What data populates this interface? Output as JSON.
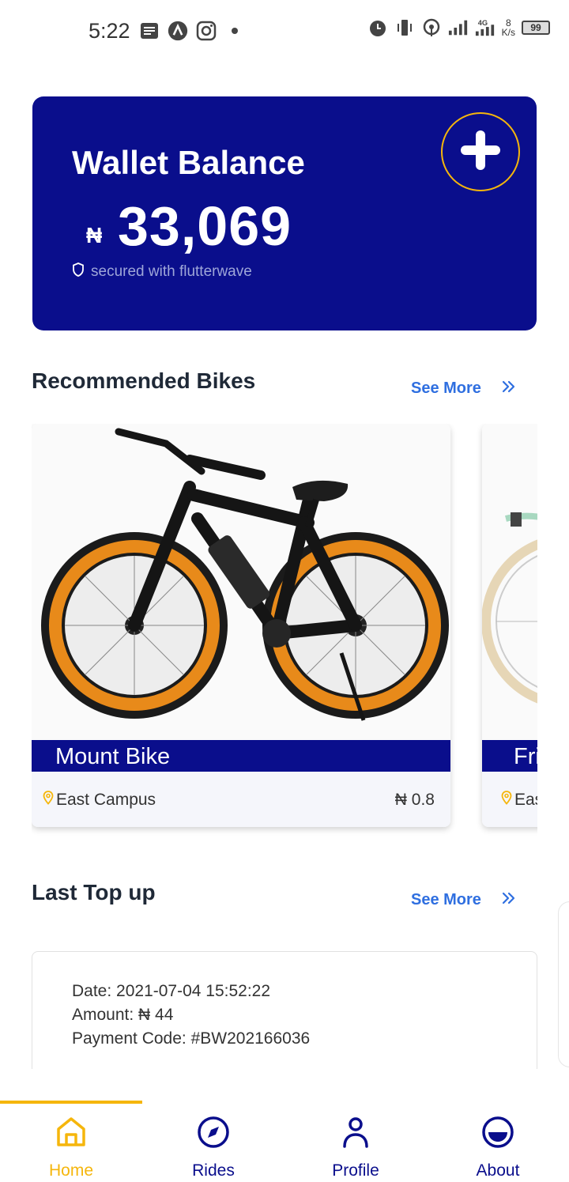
{
  "status_bar": {
    "time": "5:22",
    "net_speed_value": "8",
    "net_speed_unit": "K/s",
    "battery": "99"
  },
  "wallet": {
    "title": "Wallet Balance",
    "currency_symbol": "₦",
    "amount": "33,069",
    "secured_text": "secured with flutterwave"
  },
  "recommended": {
    "title": "Recommended Bikes",
    "see_more": "See More",
    "bikes": [
      {
        "name": "Mount Bike",
        "location": "East Campus",
        "price": "₦ 0.8"
      },
      {
        "name": "Fri",
        "location": "Eas",
        "price": ""
      }
    ]
  },
  "last_topup": {
    "title": "Last Top up",
    "see_more": "See More",
    "date": "Date: 2021-07-04 15:52:22",
    "amount": "Amount: ₦ 44",
    "payment_code": "Payment Code: #BW202166036"
  },
  "nav": {
    "items": [
      {
        "label": "Home",
        "active": true
      },
      {
        "label": "Rides",
        "active": false
      },
      {
        "label": "Profile",
        "active": false
      },
      {
        "label": "About",
        "active": false
      }
    ]
  },
  "colors": {
    "primary": "#0a0e8c",
    "accent": "#f5b60c",
    "link": "#2f6fe0"
  }
}
